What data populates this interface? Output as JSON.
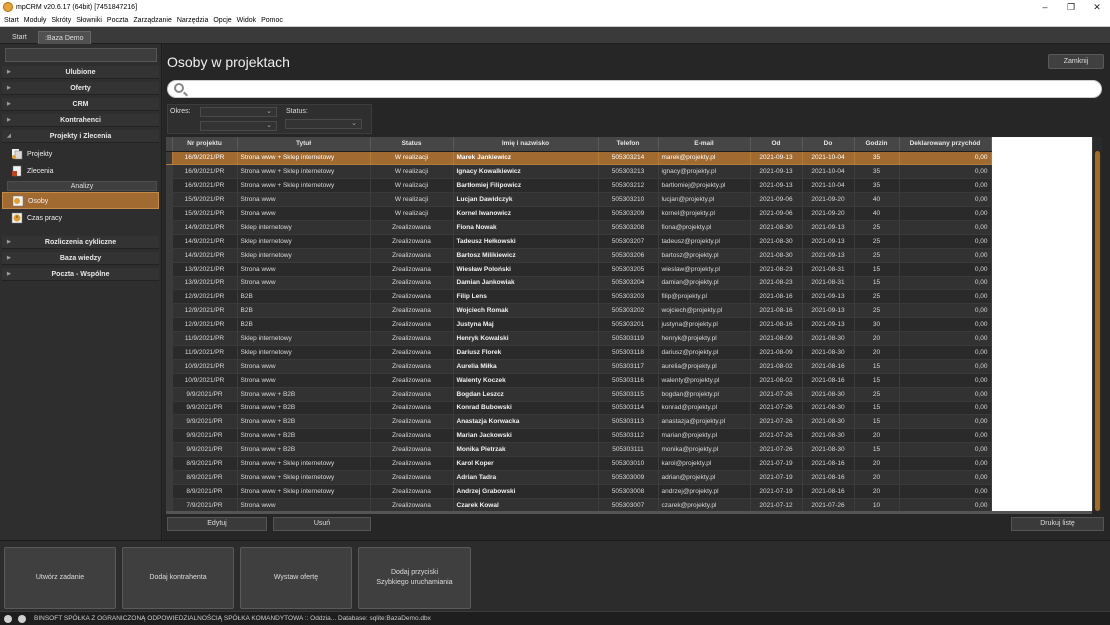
{
  "window": {
    "title": "mpCRM v20.6.17 (64bit) [7451847216]",
    "minimize": "–",
    "maximize": "❐",
    "close": "✕"
  },
  "menu": [
    "Start",
    "Moduły",
    "Skróty",
    "Słowniki",
    "Poczta",
    "Zarządzanie",
    "Narzędzia",
    "Opcje",
    "Widok",
    "Pomoc"
  ],
  "tabs": [
    "Start",
    ":Baza Demo"
  ],
  "sidebar": {
    "sections_top": [
      "Ulubione",
      "Oferty",
      "CRM",
      "Kontrahenci",
      "Projekty i Zlecenia"
    ],
    "items_a": [
      "Projekty",
      "Zlecenia"
    ],
    "subheader": "Analizy",
    "items_b": [
      "Osoby",
      "Czas pracy"
    ],
    "sections_bottom": [
      "Rozliczenia cykliczne",
      "Baza wiedzy",
      "Poczta - Wspólne"
    ]
  },
  "page": {
    "title": "Osoby w projektach",
    "close_label": "Zamknij"
  },
  "filters": {
    "period_label": "Okres:",
    "status_label": "Status:"
  },
  "table": {
    "headers": [
      "Nr projektu",
      "Tytuł",
      "Status",
      "Imię i nazwisko",
      "Telefon",
      "E-mail",
      "Od",
      "Do",
      "Godzin",
      "Deklarowany przychód"
    ],
    "rows": [
      [
        "16/9/2021/PR",
        "Strona www + Sklep internetowy",
        "W realizacji",
        "Marek Jankiewicz",
        "505303214",
        "marek@projekty.pl",
        "2021-09-13",
        "2021-10-04",
        "35",
        "0,00"
      ],
      [
        "16/9/2021/PR",
        "Strona www + Sklep internetowy",
        "W realizacji",
        "Ignacy Kowalkiewicz",
        "505303213",
        "ignacy@projekty.pl",
        "2021-09-13",
        "2021-10-04",
        "35",
        "0,00"
      ],
      [
        "16/9/2021/PR",
        "Strona www + Sklep internetowy",
        "W realizacji",
        "Bartłomiej Filipowicz",
        "505303212",
        "bartlomiej@projekty.pl",
        "2021-09-13",
        "2021-10-04",
        "35",
        "0,00"
      ],
      [
        "15/9/2021/PR",
        "Strona www",
        "W realizacji",
        "Lucjan Dawidczyk",
        "505303210",
        "lucjan@projekty.pl",
        "2021-09-06",
        "2021-09-20",
        "40",
        "0,00"
      ],
      [
        "15/9/2021/PR",
        "Strona www",
        "W realizacji",
        "Kornel Iwanowicz",
        "505303209",
        "kornel@projekty.pl",
        "2021-09-06",
        "2021-09-20",
        "40",
        "0,00"
      ],
      [
        "14/9/2021/PR",
        "Sklep internetowy",
        "Zrealizowana",
        "Fiona Nowak",
        "505303208",
        "fiona@projekty.pl",
        "2021-08-30",
        "2021-09-13",
        "25",
        "0,00"
      ],
      [
        "14/9/2021/PR",
        "Sklep internetowy",
        "Zrealizowana",
        "Tadeusz Hełkowski",
        "505303207",
        "tadeusz@projekty.pl",
        "2021-08-30",
        "2021-09-13",
        "25",
        "0,00"
      ],
      [
        "14/9/2021/PR",
        "Sklep internetowy",
        "Zrealizowana",
        "Bartosz Milikiewicz",
        "505303206",
        "bartosz@projekty.pl",
        "2021-08-30",
        "2021-09-13",
        "25",
        "0,00"
      ],
      [
        "13/9/2021/PR",
        "Strona www",
        "Zrealizowana",
        "Wiesław Poloński",
        "505303205",
        "wieslaw@projekty.pl",
        "2021-08-23",
        "2021-08-31",
        "15",
        "0,00"
      ],
      [
        "13/9/2021/PR",
        "Strona www",
        "Zrealizowana",
        "Damian Jankowiak",
        "505303204",
        "damian@projekty.pl",
        "2021-08-23",
        "2021-08-31",
        "15",
        "0,00"
      ],
      [
        "12/9/2021/PR",
        "B2B",
        "Zrealizowana",
        "Filip Lens",
        "505303203",
        "filip@projekty.pl",
        "2021-08-16",
        "2021-09-13",
        "25",
        "0,00"
      ],
      [
        "12/9/2021/PR",
        "B2B",
        "Zrealizowana",
        "Wojciech Romak",
        "505303202",
        "wojciech@projekty.pl",
        "2021-08-16",
        "2021-09-13",
        "25",
        "0,00"
      ],
      [
        "12/9/2021/PR",
        "B2B",
        "Zrealizowana",
        "Justyna Maj",
        "505303201",
        "justyna@projekty.pl",
        "2021-08-16",
        "2021-09-13",
        "30",
        "0,00"
      ],
      [
        "11/9/2021/PR",
        "Sklep internetowy",
        "Zrealizowana",
        "Henryk Kowalski",
        "505303119",
        "henryk@projekty.pl",
        "2021-08-09",
        "2021-08-30",
        "20",
        "0,00"
      ],
      [
        "11/9/2021/PR",
        "Sklep internetowy",
        "Zrealizowana",
        "Dariusz Florek",
        "505303118",
        "dariusz@projekty.pl",
        "2021-08-09",
        "2021-08-30",
        "20",
        "0,00"
      ],
      [
        "10/9/2021/PR",
        "Strona www",
        "Zrealizowana",
        "Aurelia Miłka",
        "505303117",
        "aurelia@projekty.pl",
        "2021-08-02",
        "2021-08-16",
        "15",
        "0,00"
      ],
      [
        "10/9/2021/PR",
        "Strona www",
        "Zrealizowana",
        "Walenty Koczek",
        "505303116",
        "walenty@projekty.pl",
        "2021-08-02",
        "2021-08-16",
        "15",
        "0,00"
      ],
      [
        "9/9/2021/PR",
        "Strona www + B2B",
        "Zrealizowana",
        "Bogdan Leszcz",
        "505303115",
        "bogdan@projekty.pl",
        "2021-07-26",
        "2021-08-30",
        "25",
        "0,00"
      ],
      [
        "9/9/2021/PR",
        "Strona www + B2B",
        "Zrealizowana",
        "Konrad Bubowski",
        "505303114",
        "konrad@projekty.pl",
        "2021-07-26",
        "2021-08-30",
        "15",
        "0,00"
      ],
      [
        "9/9/2021/PR",
        "Strona www + B2B",
        "Zrealizowana",
        "Anastazja Korwacka",
        "505303113",
        "anastazja@projekty.pl",
        "2021-07-26",
        "2021-08-30",
        "15",
        "0,00"
      ],
      [
        "9/9/2021/PR",
        "Strona www + B2B",
        "Zrealizowana",
        "Marian Jackowski",
        "505303112",
        "marian@projekty.pl",
        "2021-07-26",
        "2021-08-30",
        "20",
        "0,00"
      ],
      [
        "9/9/2021/PR",
        "Strona www + B2B",
        "Zrealizowana",
        "Monika Pietrzak",
        "505303111",
        "monika@projekty.pl",
        "2021-07-26",
        "2021-08-30",
        "15",
        "0,00"
      ],
      [
        "8/9/2021/PR",
        "Strona www + Sklep internetowy",
        "Zrealizowana",
        "Karol Koper",
        "505303010",
        "karol@projekty.pl",
        "2021-07-19",
        "2021-08-16",
        "20",
        "0,00"
      ],
      [
        "8/9/2021/PR",
        "Strona www + Sklep internetowy",
        "Zrealizowana",
        "Adrian Tadra",
        "505303009",
        "adrian@projekty.pl",
        "2021-07-19",
        "2021-08-16",
        "20",
        "0,00"
      ],
      [
        "8/9/2021/PR",
        "Strona www + Sklep internetowy",
        "Zrealizowana",
        "Andrzej Grabowski",
        "505303008",
        "andrzej@projekty.pl",
        "2021-07-19",
        "2021-08-16",
        "20",
        "0,00"
      ],
      [
        "7/9/2021/PR",
        "Strona www",
        "Zrealizowana",
        "Czarek Kowal",
        "505303007",
        "czarek@projekty.pl",
        "2021-07-12",
        "2021-07-26",
        "10",
        "0,00"
      ]
    ]
  },
  "buttons": {
    "edit": "Edytuj",
    "delete": "Usuń",
    "print": "Drukuj listę"
  },
  "quick": [
    "Utwórz zadanie",
    "Dodaj kontrahenta",
    "Wystaw ofertę",
    "Dodaj przyciski\nSzybkiego uruchamiania"
  ],
  "status": {
    "text": "BINSOFT SPÓŁKA Z OGRANICZONĄ ODPOWIEDZIALNOŚCIĄ SPÓŁKA KOMANDYTOWA :: Oddzia... Database: sqlite:BazaDemo.dbx"
  },
  "colors": {
    "accent": "#a06a30",
    "scrollbar": "#a76b1f"
  }
}
